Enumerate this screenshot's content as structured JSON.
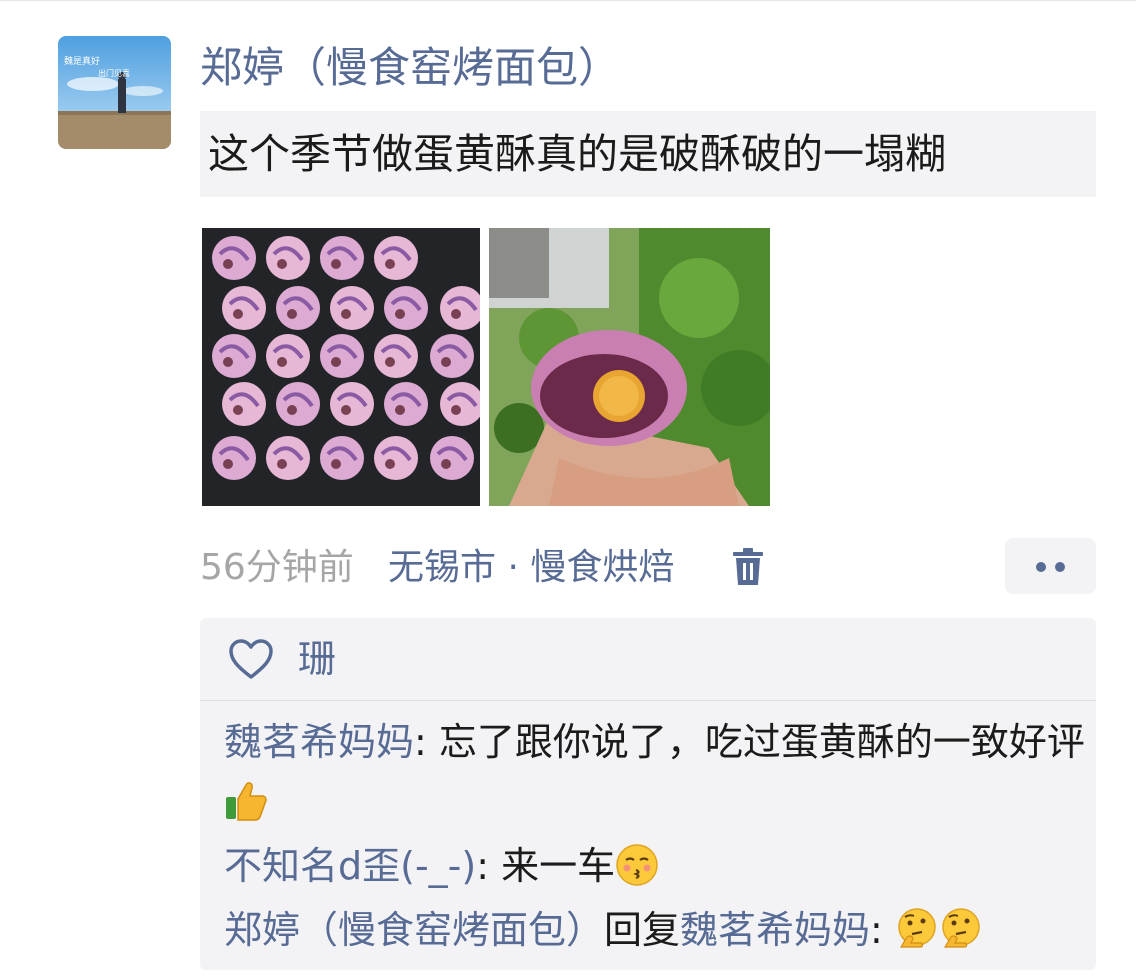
{
  "post": {
    "author": "郑婷（慢食窑烤面包）",
    "text": "这个季节做蛋黄酥真的是破酥破的一塌糊",
    "time": "56分钟前",
    "location": "无锡市 · 慢食烘焙",
    "avatar_caption": "魏是真好 出门见喜",
    "images": [
      "tray-of-pastries-photo",
      "pastry-held-in-hand-photo"
    ]
  },
  "likes": {
    "names": "珊",
    "icon": "heart-outline-icon"
  },
  "comments": [
    {
      "name": "魏茗希妈妈",
      "sep": ": ",
      "text": "忘了跟你说了，吃过蛋黄酥的一致好评",
      "emoji": [
        "thumbs-up-emoji"
      ]
    },
    {
      "name": "不知名d歪(-_-)",
      "sep": ": ",
      "text": "来一车",
      "emoji": [
        "kissing-face-emoji"
      ]
    },
    {
      "name": "郑婷（慢食窑烤面包）",
      "reply_word": "回复",
      "reply_to": "魏茗希妈妈",
      "sep": ": ",
      "text": "",
      "emoji": [
        "thinking-face-emoji",
        "thinking-face-emoji"
      ]
    }
  ],
  "colors": {
    "link": "#576b95",
    "meta_gray": "#a6a6a6",
    "panel_bg": "#f3f3f5",
    "text": "#1b1b1b"
  },
  "icons": {
    "delete": "trash-icon",
    "more": "more-dots-icon"
  }
}
